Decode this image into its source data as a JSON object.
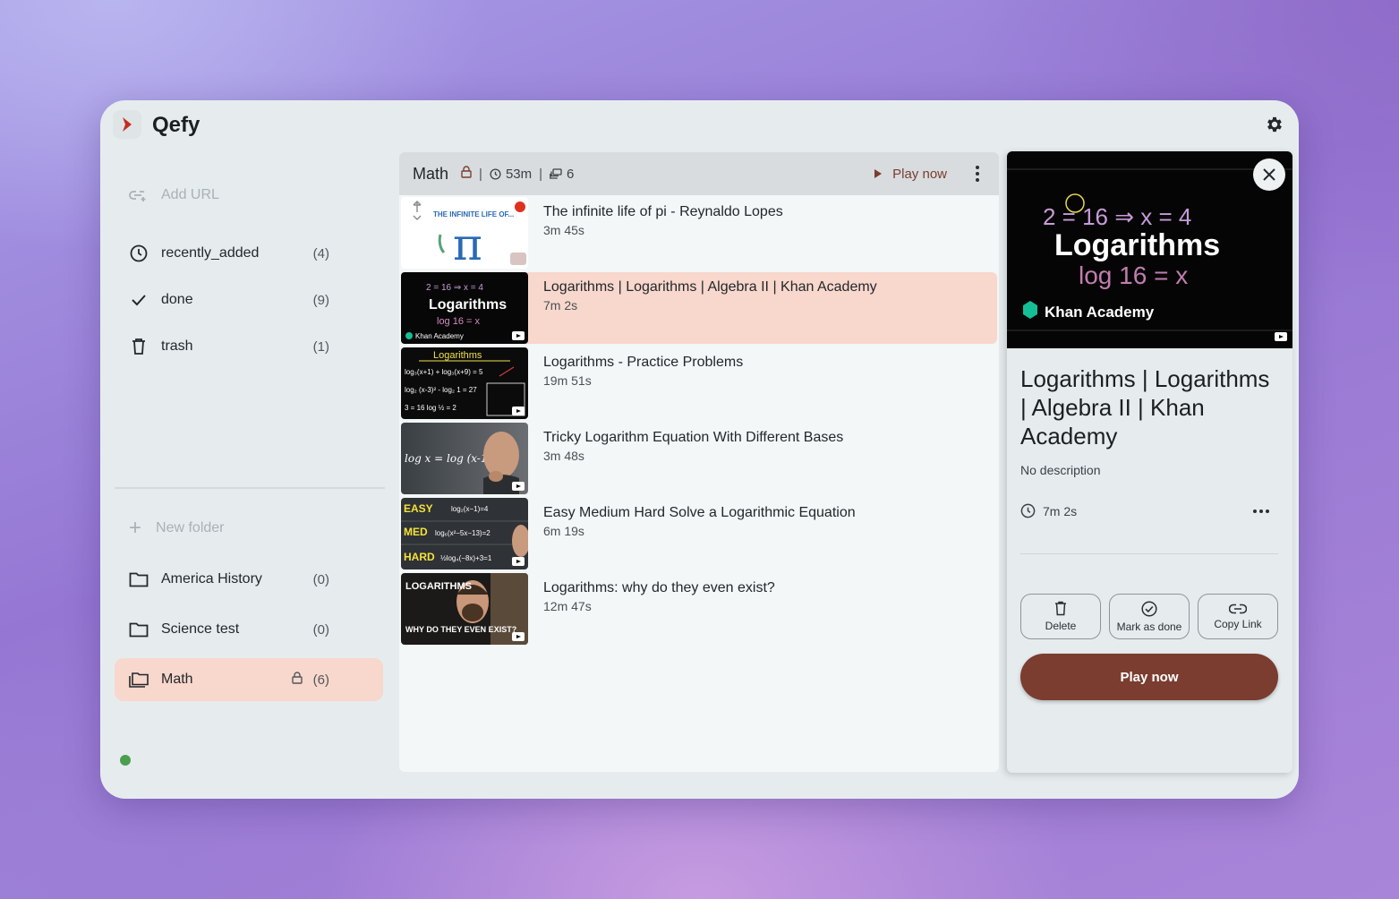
{
  "app": {
    "title": "Qefy"
  },
  "sidebar": {
    "add_url": "Add URL",
    "items": [
      {
        "label": "recently_added",
        "count": "(4)",
        "icon": "clock-icon"
      },
      {
        "label": "done",
        "count": "(9)",
        "icon": "check-icon"
      },
      {
        "label": "trash",
        "count": "(1)",
        "icon": "trash-icon"
      }
    ],
    "new_folder": "New folder",
    "folders": [
      {
        "label": "America History",
        "count": "(0)",
        "icon": "folder-icon"
      },
      {
        "label": "Science test",
        "count": "(0)",
        "icon": "folder-icon"
      },
      {
        "label": "Math",
        "count": "(6)",
        "icon": "folders-icon",
        "locked": true
      }
    ]
  },
  "list": {
    "folder_name": "Math",
    "separator": "|",
    "total_duration": "53m",
    "item_count": "6",
    "play_now": "Play now",
    "items": [
      {
        "title": "The infinite life of pi - Reynaldo Lopes",
        "duration": "3m 45s"
      },
      {
        "title": "Logarithms | Logarithms | Algebra II | Khan Academy",
        "duration": "7m 2s"
      },
      {
        "title": "Logarithms - Practice Problems",
        "duration": "19m 51s"
      },
      {
        "title": "Tricky Logarithm Equation With Different Bases",
        "duration": "3m 48s"
      },
      {
        "title": "Easy Medium Hard Solve a Logarithmic Equation",
        "duration": "6m 19s"
      },
      {
        "title": "Logarithms: why do they even exist?",
        "duration": "12m 47s"
      }
    ],
    "thumb_text": {
      "pi": "THE INFINITE LIFE OF...",
      "log": "Logarithms",
      "khan": "Khan Academy",
      "practice": "Logarithms",
      "easy": "EASY",
      "med": "MED",
      "hard": "HARD",
      "why1": "LOGARITHMS",
      "why2": "WHY DO THEY EVEN EXIST?"
    }
  },
  "detail": {
    "thumb_title": "Logarithms",
    "thumb_brand": "Khan Academy",
    "title": "Logarithms | Logarithms | Algebra II | Khan Academy",
    "description": "No description",
    "duration": "7m 2s",
    "actions": {
      "delete": "Delete",
      "mark_done": "Mark as done",
      "copy_link": "Copy Link"
    },
    "play_now": "Play now"
  },
  "colors": {
    "accent": "#7a3d2f",
    "selected": "#f8d7cc",
    "status": "#4a9e4f"
  }
}
